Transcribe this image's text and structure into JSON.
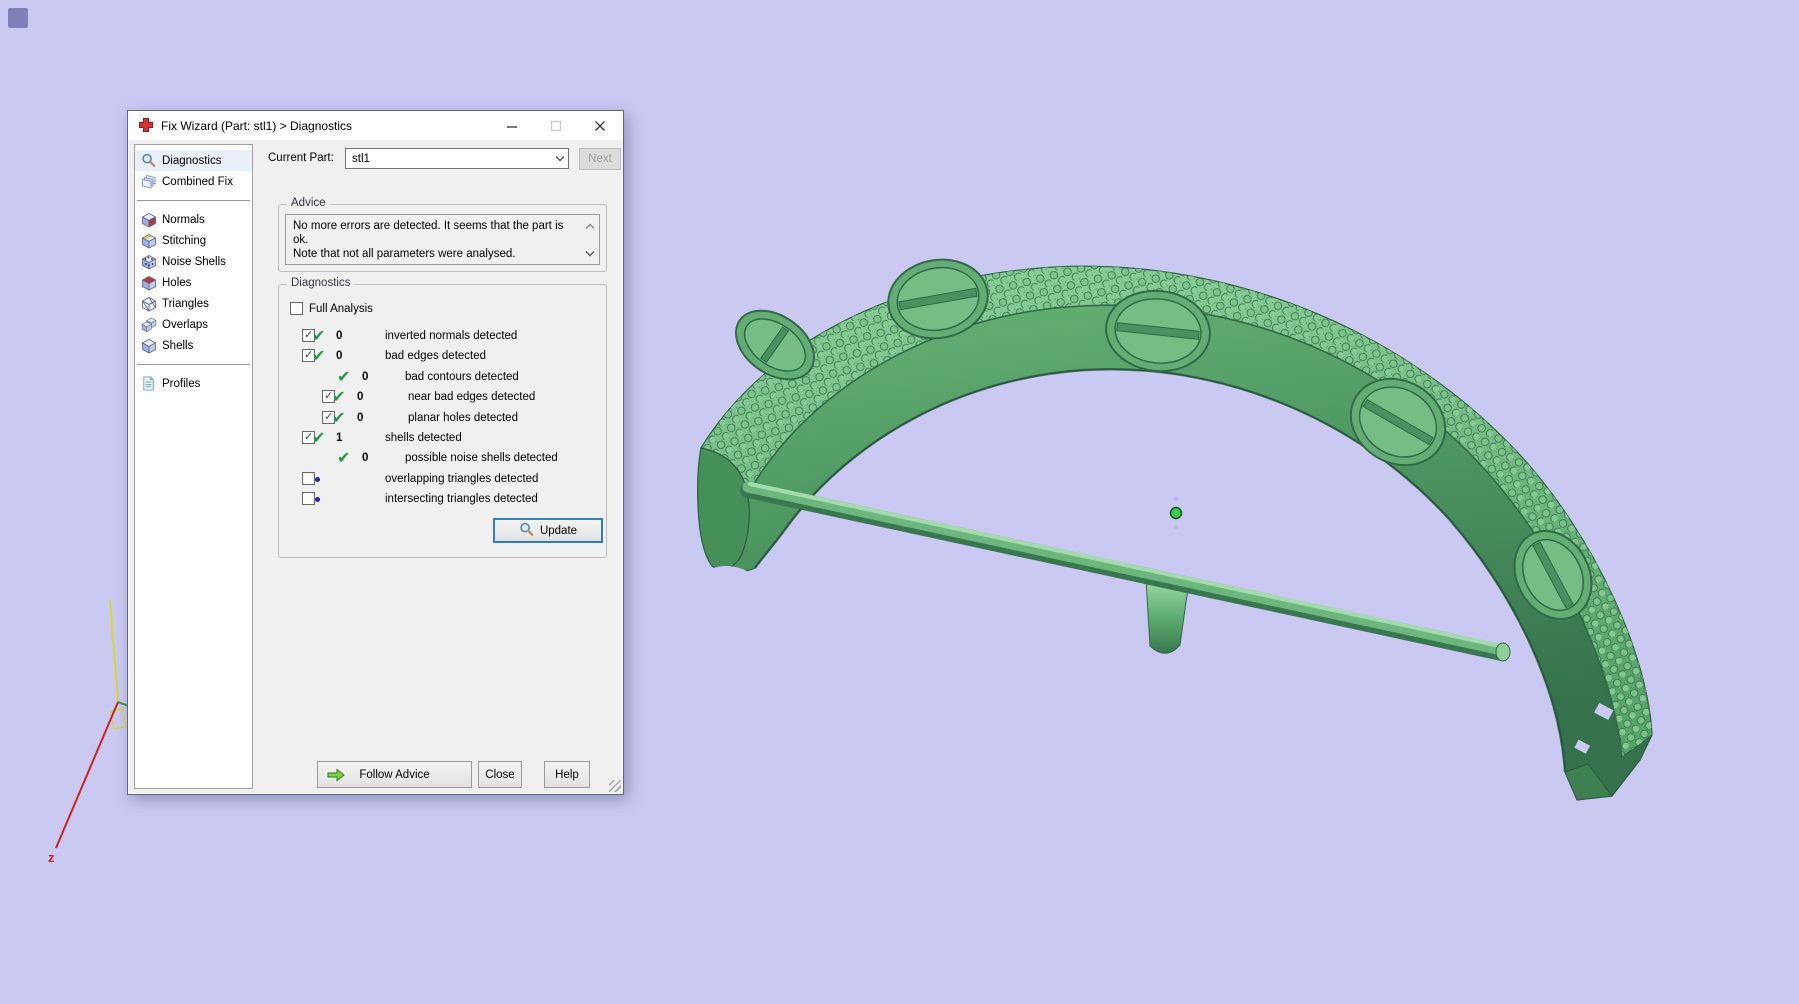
{
  "window": {
    "title": "Fix Wizard (Part: stl1) > Diagnostics",
    "icons": {
      "app": "red-cross-icon",
      "minimize": "minimize-icon",
      "maximize": "maximize-icon",
      "close": "close-icon"
    }
  },
  "current_part": {
    "label": "Current Part:",
    "value": "stl1",
    "chevron_icon": "chevron-down-icon",
    "next_label": "Next"
  },
  "sidebar": {
    "groups": [
      {
        "items": [
          {
            "label": "Diagnostics",
            "icon": "magnifier-icon",
            "selected": true
          },
          {
            "label": "Combined Fix",
            "icon": "combined-fix-icon",
            "selected": false
          }
        ]
      },
      {
        "items": [
          {
            "label": "Normals",
            "icon": "cube-normals-icon",
            "selected": false
          },
          {
            "label": "Stitching",
            "icon": "cube-stitching-icon",
            "selected": false
          },
          {
            "label": "Noise Shells",
            "icon": "cube-noise-icon",
            "selected": false
          },
          {
            "label": "Holes",
            "icon": "cube-holes-icon",
            "selected": false
          },
          {
            "label": "Triangles",
            "icon": "cube-triangles-icon",
            "selected": false
          },
          {
            "label": "Overlaps",
            "icon": "cube-overlaps-icon",
            "selected": false
          },
          {
            "label": "Shells",
            "icon": "cube-shells-icon",
            "selected": false
          }
        ]
      },
      {
        "items": [
          {
            "label": "Profiles",
            "icon": "profiles-icon",
            "selected": false
          }
        ]
      }
    ]
  },
  "advice": {
    "title": "Advice",
    "line1": "No more errors are detected. It seems that the part is ok.",
    "line2": "Note that not all parameters were analysed.",
    "scroll_up_icon": "chevron-up-icon",
    "scroll_down_icon": "chevron-down-icon"
  },
  "diagnostics": {
    "title": "Diagnostics",
    "full_analysis_label": "Full Analysis",
    "full_analysis_checked": false,
    "rows": [
      {
        "checkbox": true,
        "checked": true,
        "status": "check",
        "count": "0",
        "label": "inverted normals detected",
        "indent": 0
      },
      {
        "checkbox": true,
        "checked": true,
        "status": "check",
        "count": "0",
        "label": "bad edges detected",
        "indent": 0
      },
      {
        "checkbox": false,
        "checked": false,
        "status": "check",
        "count": "0",
        "label": "bad contours detected",
        "indent": 2
      },
      {
        "checkbox": true,
        "checked": true,
        "status": "check",
        "count": "0",
        "label": "near bad edges detected",
        "indent": 1
      },
      {
        "checkbox": true,
        "checked": true,
        "status": "check",
        "count": "0",
        "label": "planar holes detected",
        "indent": 1
      },
      {
        "checkbox": true,
        "checked": true,
        "status": "check",
        "count": "1",
        "label": "shells detected",
        "indent": 0
      },
      {
        "checkbox": false,
        "checked": false,
        "status": "check",
        "count": "0",
        "label": "possible noise shells detected",
        "indent": 2
      },
      {
        "checkbox": true,
        "checked": false,
        "status": "dot",
        "count": "",
        "label": "overlapping triangles detected",
        "indent": 0
      },
      {
        "checkbox": true,
        "checked": false,
        "status": "dot",
        "count": "",
        "label": "intersecting triangles detected",
        "indent": 0
      }
    ],
    "update_label": "Update",
    "update_icon": "magnifier-icon"
  },
  "footer": {
    "follow_advice_label": "Follow Advice",
    "follow_advice_icon": "green-arrow-icon",
    "close_label": "Close",
    "help_label": "Help"
  },
  "viewport": {
    "axis_z_label": "z",
    "colors": {
      "background": "#c9c9f2",
      "model_green_mid": "#4f9a63",
      "model_green_dark": "#2f6b44",
      "model_green_light": "#9fd6a8",
      "status_check_green": "#1e9b43",
      "status_dot_blue": "#2323b8",
      "focus_border_blue": "#2e7fc2",
      "axis_red": "#cc2222",
      "axis_yellow": "#d8d832",
      "axis_green": "#2aa82a"
    }
  }
}
